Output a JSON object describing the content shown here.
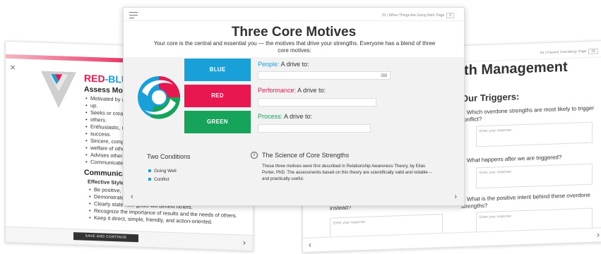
{
  "left_card": {
    "title_red": "RED",
    "title_sep": "-",
    "title_blue": "BLUE",
    "section1": "Assess Motives",
    "bullets1": [
      "Motivated by a co",
      "up.",
      "Seeks or creates c",
      "others.",
      "Enthusiastic, optin",
      "success.",
      "Sincere, compassi",
      "welfare of others.",
      "Advises others ho",
      "Communicates wh"
    ],
    "section2": "Communicate in",
    "effective_style": "Effective Style:",
    "bullets2": [
      "Be positive, enth",
      "Demonstrate sin",
      "Clearly state how goals will benefit others.",
      "Recognize the importance of results and the needs of others.",
      "Keep it direct, simple, friendly, and action-oriented."
    ],
    "save_button": "SAVE AND CONTINUE",
    "close": "×",
    "next": "›"
  },
  "center_card": {
    "breadcrumb": "01 | When Things Are Going Well: Page",
    "page_num": "0",
    "title": "Three Core Motives",
    "subtitle": "Your core is the central and essential you — the motives that drive your strengths. Everyone has a blend of three core motives:",
    "motives": [
      {
        "block": "BLUE",
        "name": "People:",
        "rest": " A drive to:",
        "color": "#1aa0d8"
      },
      {
        "block": "RED",
        "name": "Performance:",
        "rest": " A drive to:",
        "color": "#e8174f"
      },
      {
        "block": "GREEN",
        "name": "Process:",
        "rest": " A drive to:",
        "color": "#16a35a"
      }
    ],
    "conditions_title": "Two Conditions",
    "conditions": [
      "Going Well",
      "Conflict"
    ],
    "science_title": "The Science of Core Strengths",
    "science_body": "These three motives were first described in Relationship Awareness Theory, by Elias Porter, PhD. The assessments based on this theory are scientifically valid and reliable – and practically useful.",
    "info_icon": "i",
    "prev": "‹",
    "next": "›"
  },
  "right_card": {
    "breadcrumb": "04 | Prevent Overdoing: Page",
    "page_num": "08",
    "title": "th Management",
    "triggers": "Our Triggers:",
    "questions": [
      "Which overdone strengths are most likely to trigger conflict?",
      "What happens after we are triggered?",
      "What is the positive intent behind these overdone strengths?"
    ],
    "response_placeholder": "Enter your response",
    "left_question": "instead?",
    "prev": "‹",
    "next": "›"
  }
}
